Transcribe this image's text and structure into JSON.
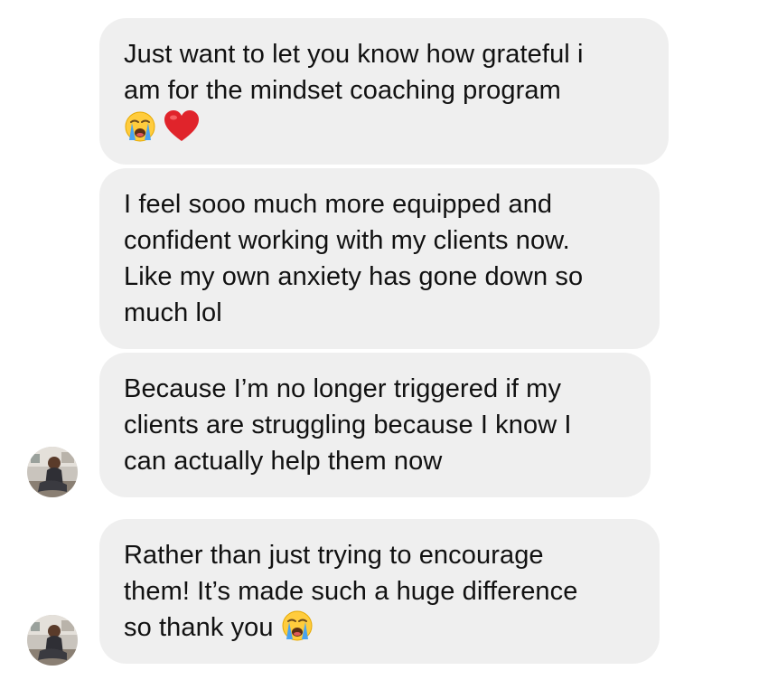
{
  "conversation": {
    "messages": [
      {
        "lines": [
          "Just want to let you know how grateful i",
          "am for the mindset coaching program"
        ],
        "emojis": [
          "crying-face-emoji",
          "red-heart-emoji"
        ]
      },
      {
        "lines": [
          "I feel sooo much more equipped and",
          "confident working with my clients now.",
          "Like my own anxiety has gone down so",
          "much lol"
        ]
      },
      {
        "lines": [
          "Because I’m no longer triggered if my",
          "clients are struggling because I know I",
          "can actually help them now"
        ]
      },
      {
        "lines": [
          "Rather than just trying to encourage",
          "them! It’s made such a huge difference",
          "so thank you"
        ],
        "emojis": [
          "crying-face-emoji"
        ]
      }
    ]
  },
  "colors": {
    "bubble_background": "#efefef",
    "text": "#111111",
    "heart": "#e0242b",
    "crying_face": "#ffcc3d",
    "tears": "#4aa3ef"
  }
}
